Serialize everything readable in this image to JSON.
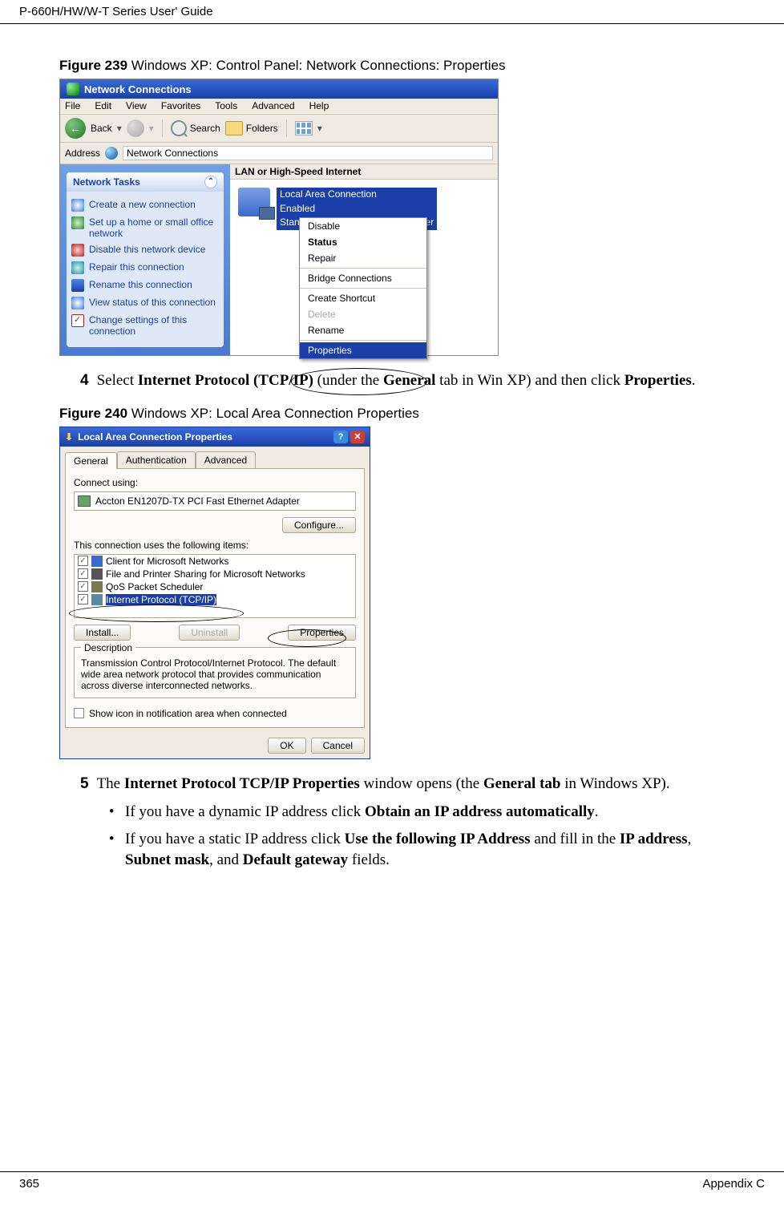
{
  "page": {
    "header_left": "P-660H/HW/W-T Series User' Guide",
    "footer_page": "365",
    "footer_label": "Appendix C"
  },
  "fig239": {
    "label_prefix": "Figure 239   ",
    "label_text": "Windows XP: Control Panel: Network Connections: Properties",
    "window_title": "Network Connections",
    "menu": {
      "file": "File",
      "edit": "Edit",
      "view": "View",
      "favorites": "Favorites",
      "tools": "Tools",
      "advanced": "Advanced",
      "help": "Help"
    },
    "toolbar": {
      "back": "Back",
      "search": "Search",
      "folders": "Folders"
    },
    "address_label": "Address",
    "address_value": "Network Connections",
    "panel_title": "Network Tasks",
    "tasks": [
      "Create a new connection",
      "Set up a home or small office network",
      "Disable this network device",
      "Repair this connection",
      "Rename this connection",
      "View status of this connection",
      "Change settings of this connection"
    ],
    "category": "LAN or High-Speed Internet",
    "conn": {
      "name": "Local Area Connection",
      "status": "Enabled",
      "adapter": "Standard PCI Fast Ethernet Adapter"
    },
    "ctx": {
      "disable": "Disable",
      "status": "Status",
      "repair": "Repair",
      "bridge": "Bridge Connections",
      "shortcut": "Create Shortcut",
      "delete": "Delete",
      "rename": "Rename",
      "properties": "Properties"
    }
  },
  "step4": {
    "num": "4",
    "t1": "Select ",
    "b1": "Internet Protocol (TCP/IP)",
    "t2": " (under the ",
    "b2": "General",
    "t3": " tab in Win XP) and then click ",
    "b3": "Properties",
    "t4": "."
  },
  "fig240": {
    "label_prefix": "Figure 240   ",
    "label_text": "Windows XP: Local Area Connection Properties",
    "window_title": "Local Area Connection Properties",
    "tabs": {
      "general": "General",
      "auth": "Authentication",
      "adv": "Advanced"
    },
    "connect_using": "Connect using:",
    "adapter": "Accton EN1207D-TX PCI Fast Ethernet Adapter",
    "configure": "Configure...",
    "uses_items": "This connection uses the following items:",
    "items": [
      "Client for Microsoft Networks",
      "File and Printer Sharing for Microsoft Networks",
      "QoS Packet Scheduler",
      "Internet Protocol (TCP/IP)"
    ],
    "install": "Install...",
    "uninstall": "Uninstall",
    "properties": "Properties",
    "desc_legend": "Description",
    "desc_text": "Transmission Control Protocol/Internet Protocol. The default wide area network protocol that provides communication across diverse interconnected networks.",
    "show_icon": "Show icon in notification area when connected",
    "ok": "OK",
    "cancel": "Cancel"
  },
  "step5": {
    "num": "5",
    "t1": "The ",
    "b1": "Internet Protocol TCP/IP Properties",
    "t2": " window opens (the ",
    "b2": "General tab",
    "t3": " in Windows XP)."
  },
  "bullets": {
    "b1": {
      "t1": "If you have a dynamic IP address click ",
      "b1": "Obtain an IP address automatically",
      "t2": "."
    },
    "b2": {
      "t1": "If you have a static IP address click ",
      "b1": "Use the following IP Address",
      "t2": " and fill in the ",
      "b2": "IP address",
      "t3": ", ",
      "b3": "Subnet mask",
      "t4": ", and ",
      "b4": "Default gateway",
      "t5": " fields."
    }
  }
}
